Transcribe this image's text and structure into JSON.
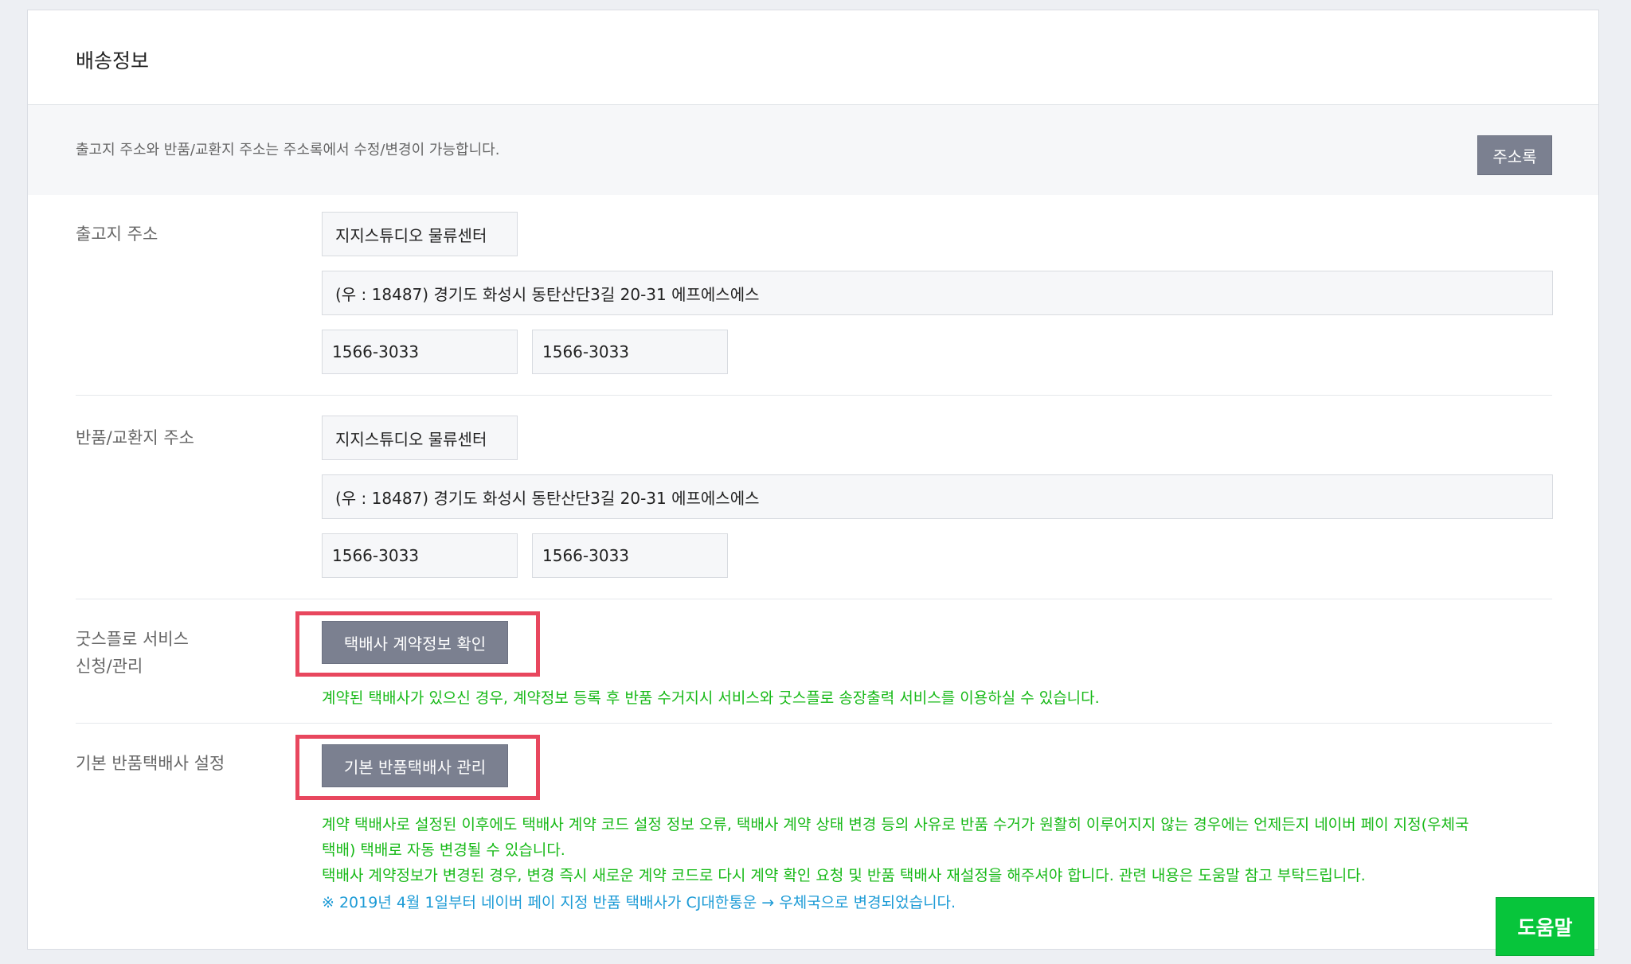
{
  "panel": {
    "title": "배송정보",
    "notice": "출고지 주소와 반품/교환지 주소는 주소록에서 수정/변경이 가능합니다.",
    "address_book_button": "주소록"
  },
  "shipping_origin": {
    "label": "출고지 주소",
    "name": "지지스튜디오 물류센터",
    "address": "(우 : 18487)  경기도 화성시 동탄산단3길 20-31 에프에스에스",
    "phone1": "1566-3033",
    "phone2": "1566-3033"
  },
  "return_address": {
    "label": "반품/교환지 주소",
    "name": "지지스튜디오 물류센터",
    "address": "(우 : 18487)  경기도 화성시 동탄산단3길 20-31 에프에스에스",
    "phone1": "1566-3033",
    "phone2": "1566-3033"
  },
  "goodsflow": {
    "label_line1": "굿스플로 서비스",
    "label_line2": "신청/관리",
    "button": "택배사 계약정보 확인",
    "note": "계약된 택배사가 있으신 경우, 계약정보 등록 후 반품 수거지시 서비스와 굿스플로 송장출력 서비스를 이용하실 수 있습니다."
  },
  "default_return_courier": {
    "label": "기본 반품택배사 설정",
    "button": "기본 반품택배사 관리",
    "note1_line1": "계약 택배사로 설정된 이후에도 택배사 계약 코드 설정 정보 오류, 택배사 계약 상태 변경 등의 사유로 반품 수거가 원활히 이루어지지 않는 경우에는 언제든지 네이버 페이 지정(우체국",
    "note1_line2": "택배) 택배로 자동 변경될 수 있습니다.",
    "note2": "택배사 계약정보가 변경된 경우, 변경 즉시 새로운 계약 코드로 다시 계약 확인 요청 및 반품 택배사 재설정을 해주셔야 합니다. 관련 내용은 도움말 참고 부탁드립니다.",
    "note3": "※ 2019년 4월 1일부터 네이버 페이 지정 반품 택배사가 CJ대한통운 → 우체국으로 변경되었습니다."
  },
  "help_button": "도움말",
  "colors": {
    "highlight_box": "#e8475e",
    "note_green": "#17b917",
    "note_blue": "#1d9bd6",
    "button_gray": "#7b8090",
    "help_green": "#07c53b"
  }
}
